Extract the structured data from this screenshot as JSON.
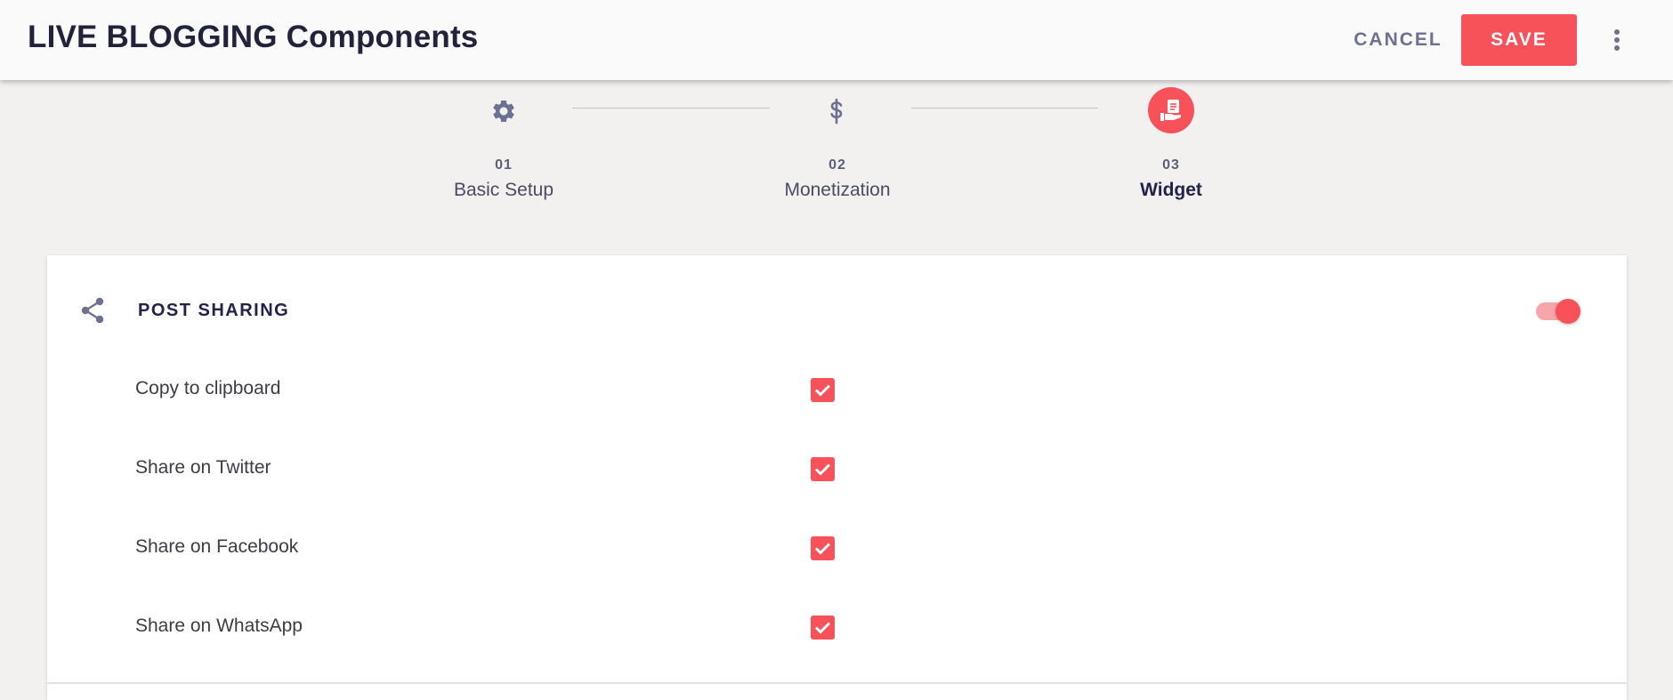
{
  "header": {
    "title": "LIVE BLOGGING Components",
    "cancel_label": "CANCEL",
    "save_label": "SAVE",
    "more_icon": "more-vertical-icon"
  },
  "stepper": {
    "steps": [
      {
        "number": "01",
        "label": "Basic Setup",
        "icon": "gear-icon",
        "active": false
      },
      {
        "number": "02",
        "label": "Monetization",
        "icon": "dollar-icon",
        "active": false
      },
      {
        "number": "03",
        "label": "Widget",
        "icon": "widget-icon",
        "active": true
      }
    ]
  },
  "section": {
    "title": "POST SHARING",
    "icon": "share-icon",
    "enabled": true,
    "options": [
      {
        "label": "Copy to clipboard",
        "checked": true
      },
      {
        "label": "Share on Twitter",
        "checked": true
      },
      {
        "label": "Share on Facebook",
        "checked": true
      },
      {
        "label": "Share on WhatsApp",
        "checked": true
      }
    ]
  },
  "colors": {
    "accent": "#f7525a",
    "icon_muted": "#6d7191",
    "background": "#f2f1f0"
  }
}
